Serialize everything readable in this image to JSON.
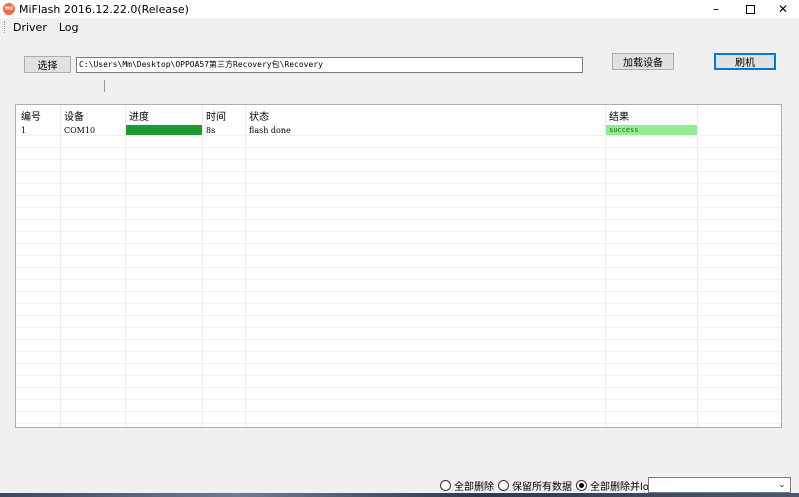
{
  "window": {
    "app_icon_text": "mi",
    "title": "MiFlash 2016.12.22.0(Release)",
    "minimize": "–",
    "close": "✕"
  },
  "menu": {
    "items": [
      "Driver",
      "Log"
    ]
  },
  "toolbar": {
    "select_label": "选择",
    "path_value": "C:\\Users\\Mm\\Desktop\\OPPOA57第三方Recovery包\\Recovery",
    "load_devices_label": "加载设备",
    "flash_label": "刷机"
  },
  "table": {
    "columns": [
      "编号",
      "设备",
      "进度",
      "时间",
      "状态",
      "结果"
    ],
    "rows": [
      {
        "id": "1",
        "device": "COM10",
        "progress": 1.0,
        "time": "8s",
        "status": "flash done",
        "result": "success"
      }
    ]
  },
  "options": {
    "radios": [
      {
        "label": "全部删除",
        "checked": false
      },
      {
        "label": "保留所有数据",
        "checked": false
      },
      {
        "label": "全部删除并lock",
        "checked": true
      }
    ],
    "dropdown_value": ""
  },
  "colors": {
    "progress": "#1e9b2e",
    "success": "#90ee90"
  }
}
